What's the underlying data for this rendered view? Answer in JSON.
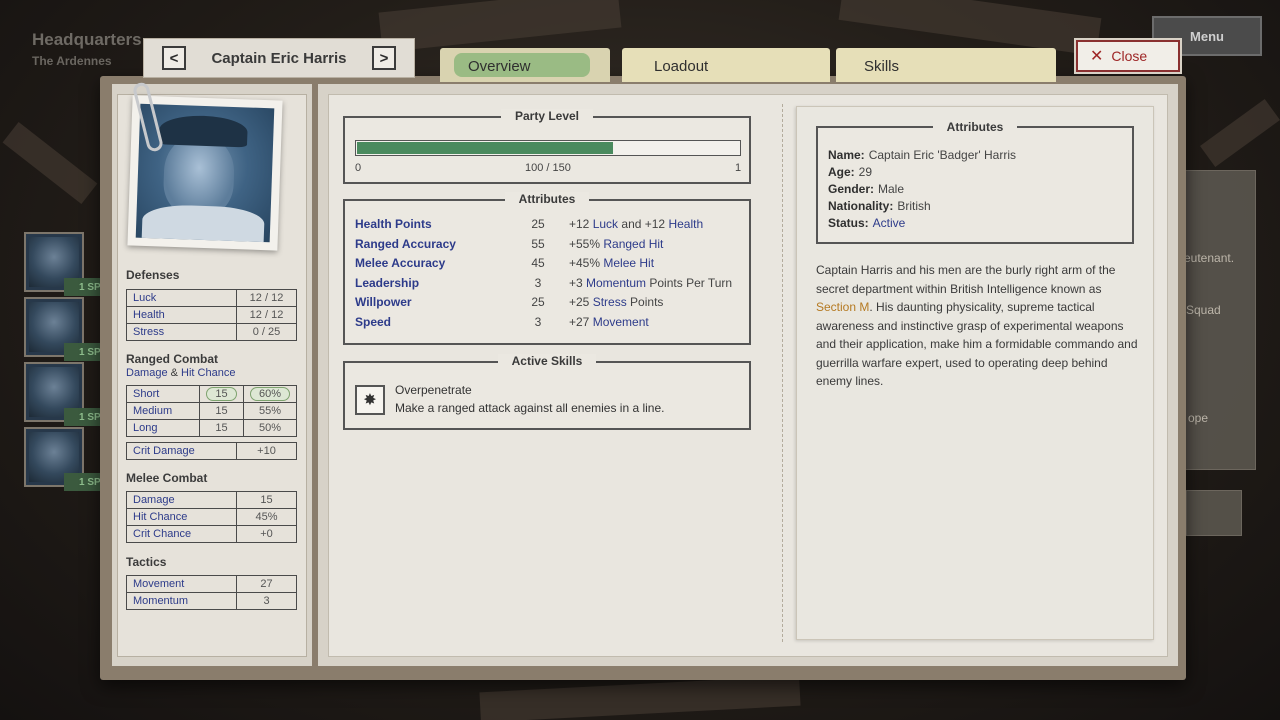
{
  "location": {
    "title": "Headquarters",
    "subtitle": "The Ardennes"
  },
  "menu_label": "Menu",
  "background_text": {
    "line1": "eutenant.",
    "line2": "Squad",
    "line3": "ope"
  },
  "roster": [
    {
      "sp": "1 SP!"
    },
    {
      "sp": "1 SP!"
    },
    {
      "sp": "1 SP!"
    },
    {
      "sp": "1 SP!"
    }
  ],
  "character": {
    "name": "Captain Eric Harris",
    "prev": "<",
    "next": ">"
  },
  "tabs": {
    "overview": "Overview",
    "loadout": "Loadout",
    "skills": "Skills",
    "active": "overview"
  },
  "close_label": "Close",
  "defenses": {
    "title": "Defenses",
    "rows": [
      {
        "label": "Luck",
        "value": "12 / 12"
      },
      {
        "label": "Health",
        "value": "12 / 12"
      },
      {
        "label": "Stress",
        "value": "0 / 25"
      }
    ]
  },
  "ranged": {
    "title": "Ranged Combat",
    "sub_a": "Damage",
    "sub_amp": "&",
    "sub_b": "Hit Chance",
    "rows": [
      {
        "label": "Short",
        "damage": "15",
        "hit": "60%"
      },
      {
        "label": "Medium",
        "damage": "15",
        "hit": "55%"
      },
      {
        "label": "Long",
        "damage": "15",
        "hit": "50%"
      }
    ],
    "crit_label": "Crit Damage",
    "crit_value": "+10"
  },
  "melee": {
    "title": "Melee Combat",
    "rows": [
      {
        "label": "Damage",
        "value": "15"
      },
      {
        "label": "Hit Chance",
        "value": "45%"
      },
      {
        "label": "Crit Chance",
        "value": "+0"
      }
    ]
  },
  "tactics": {
    "title": "Tactics",
    "rows": [
      {
        "label": "Movement",
        "value": "27"
      },
      {
        "label": "Momentum",
        "value": "3"
      }
    ]
  },
  "party_level": {
    "title": "Party Level",
    "min": "0",
    "current": "100 / 150",
    "max": "1",
    "progress": 0.667
  },
  "attributes": {
    "title": "Attributes",
    "rows": [
      {
        "name": "Health Points",
        "value": "25",
        "d": [
          [
            "+12 ",
            false
          ],
          [
            "Luck",
            true
          ],
          [
            " and +12 ",
            false
          ],
          [
            "Health",
            true
          ]
        ]
      },
      {
        "name": "Ranged Accuracy",
        "value": "55",
        "d": [
          [
            "+55% ",
            false
          ],
          [
            "Ranged Hit",
            true
          ]
        ]
      },
      {
        "name": "Melee Accuracy",
        "value": "45",
        "d": [
          [
            "+45% ",
            false
          ],
          [
            "Melee Hit",
            true
          ]
        ]
      },
      {
        "name": "Leadership",
        "value": "3",
        "d": [
          [
            "+3 ",
            false
          ],
          [
            "Momentum",
            true
          ],
          [
            " Points Per Turn",
            false
          ]
        ]
      },
      {
        "name": "Willpower",
        "value": "25",
        "d": [
          [
            "+25 ",
            false
          ],
          [
            "Stress",
            true
          ],
          [
            " Points",
            false
          ]
        ]
      },
      {
        "name": "Speed",
        "value": "3",
        "d": [
          [
            "+27 ",
            false
          ],
          [
            "Movement",
            true
          ]
        ]
      }
    ]
  },
  "active_skills": {
    "title": "Active Skills",
    "name": "Overpenetrate",
    "desc": "Make a ranged attack against all enemies in a line.",
    "icon": "crosshair-shot-icon"
  },
  "bio": {
    "title": "Attributes",
    "name_label": "Name:",
    "name": "Captain Eric 'Badger' Harris",
    "age_label": "Age:",
    "age": "29",
    "gender_label": "Gender:",
    "gender": "Male",
    "nationality_label": "Nationality:",
    "nationality": "British",
    "status_label": "Status:",
    "status": "Active",
    "text_a": "Captain Harris and his men are the burly right arm of the secret department within British Intelligence known as ",
    "text_hl": "Section M",
    "text_b": ". His daunting physicality, supreme tactical awareness and instinctive grasp of experimental weapons and their application, make him a formidable commando and guerrilla warfare expert, used to operating deep behind enemy lines."
  },
  "colors": {
    "link_blue": "#2d3b8a",
    "accent_green": "#4a8a5e",
    "close_red": "#9e2626",
    "highlight_orange": "#b57a22"
  }
}
